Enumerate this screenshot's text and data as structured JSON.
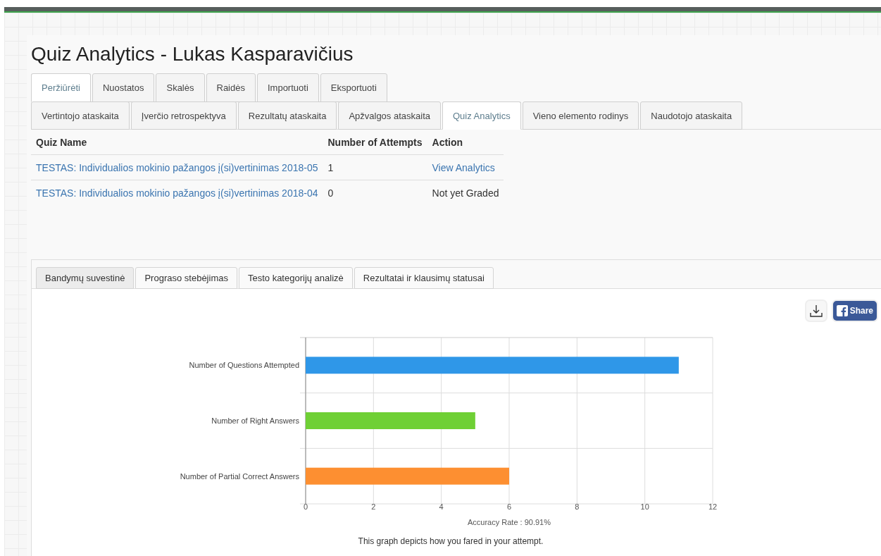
{
  "page_title": "Quiz Analytics - Lukas Kasparavičius",
  "main_tabs": [
    {
      "label": "Peržiūrėti",
      "selected": true
    },
    {
      "label": "Nuostatos",
      "selected": false
    },
    {
      "label": "Skalės",
      "selected": false
    },
    {
      "label": "Raidės",
      "selected": false
    },
    {
      "label": "Importuoti",
      "selected": false
    },
    {
      "label": "Eksportuoti",
      "selected": false
    }
  ],
  "report_tabs": [
    {
      "label": "Vertintojo ataskaita",
      "selected": false
    },
    {
      "label": "Įverčio retrospektyva",
      "selected": false
    },
    {
      "label": "Rezultatų ataskaita",
      "selected": false
    },
    {
      "label": "Apžvalgos ataskaita",
      "selected": false
    },
    {
      "label": "Quiz Analytics",
      "selected": true
    },
    {
      "label": "Vieno elemento rodinys",
      "selected": false
    },
    {
      "label": "Naudotojo ataskaita",
      "selected": false
    }
  ],
  "table": {
    "columns": [
      "Quiz Name",
      "Number of Attempts",
      "Action"
    ],
    "rows": [
      {
        "quiz_name": "TESTAS: Individualios mokinio pažangos į(si)vertinimas 2018-05",
        "attempts": "1",
        "action": {
          "kind": "link",
          "text": "View Analytics"
        }
      },
      {
        "quiz_name": "TESTAS: Individualios mokinio pažangos į(si)vertinimas 2018-04",
        "attempts": "0",
        "action": {
          "kind": "text",
          "text": "Not yet Graded"
        }
      }
    ]
  },
  "analysis_tabs": [
    {
      "label": "Bandymų suvestinė",
      "selected": true
    },
    {
      "label": "Prograso stebėjimas",
      "selected": false
    },
    {
      "label": "Testo kategorijų analizė",
      "selected": false
    },
    {
      "label": "Rezultatai ir klausimų statusai",
      "selected": false
    }
  ],
  "share_button": {
    "label": "Share"
  },
  "chart_data": {
    "type": "bar",
    "orientation": "horizontal",
    "xlabel": "Accuracy Rate : 90.91%",
    "categories": [
      "Number of Questions Attempted",
      "Number of Right Answers",
      "Number of Partial Correct Answers"
    ],
    "values": [
      11,
      5,
      6
    ],
    "colors": [
      "#2f97e8",
      "#6fd035",
      "#fd8f31"
    ],
    "xlim": [
      0,
      12
    ],
    "xticks": [
      0,
      2,
      4,
      6,
      8,
      10,
      12
    ],
    "grid": true
  },
  "caption": "This graph depicts how you fared in your attempt."
}
